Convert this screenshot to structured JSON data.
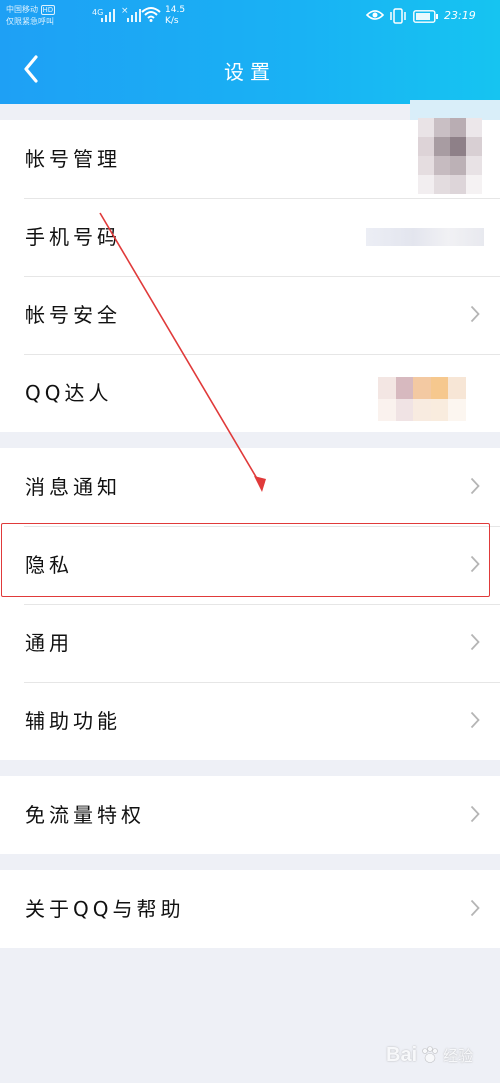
{
  "status_bar": {
    "carrier_line1": "中国移动",
    "carrier_tag": "HD",
    "carrier_line2": "仅限紧急呼叫",
    "network": "4G",
    "net_speed_value": "14.5",
    "net_speed_unit": "K/s",
    "time": "23:19"
  },
  "header": {
    "title": "设置"
  },
  "groups": [
    {
      "items": [
        {
          "label": "帐号管理"
        },
        {
          "label": "手机号码"
        },
        {
          "label": "帐号安全"
        },
        {
          "label": "QQ达人"
        }
      ]
    },
    {
      "items": [
        {
          "label": "消息通知"
        },
        {
          "label": "隐私"
        },
        {
          "label": "通用"
        },
        {
          "label": "辅助功能"
        }
      ]
    },
    {
      "items": [
        {
          "label": "免流量特权"
        }
      ]
    },
    {
      "items": [
        {
          "label": "关于QQ与帮助"
        }
      ]
    }
  ],
  "colors": {
    "header_gradient_start": "#1ea0f5",
    "header_gradient_end": "#16c4f1",
    "annotation_red": "#e03a3a",
    "page_background": "#eef0f6"
  },
  "icons": {
    "back": "chevron-left-icon",
    "row_arrow": "chevron-right-icon",
    "eye": "eye-icon",
    "vibrate": "vibrate-icon",
    "battery": "battery-icon",
    "wifi": "wifi-icon"
  },
  "watermark": {
    "text": "Bai",
    "sub": "经验"
  }
}
